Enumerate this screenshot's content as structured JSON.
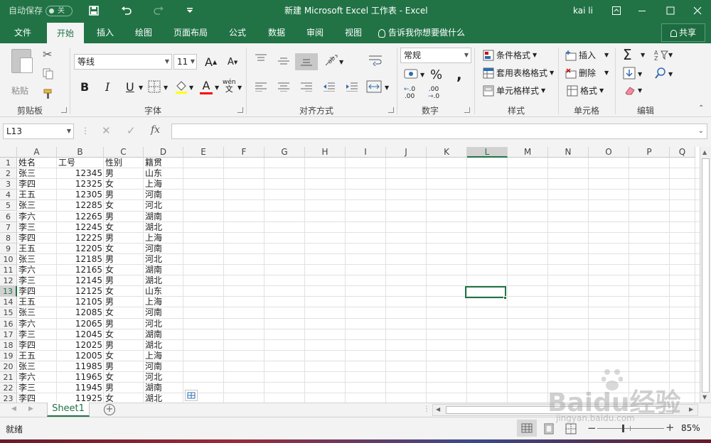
{
  "titlebar": {
    "autosave_label": "自动保存",
    "autosave_state": "关",
    "title": "新建 Microsoft Excel 工作表  -  Excel",
    "user": "kai li"
  },
  "tabs": [
    "文件",
    "开始",
    "插入",
    "绘图",
    "页面布局",
    "公式",
    "数据",
    "审阅",
    "视图"
  ],
  "tell_me": "告诉我你想要做什么",
  "share": "共享",
  "ribbon": {
    "clipboard": {
      "paste": "粘贴",
      "label": "剪贴板"
    },
    "font": {
      "name": "等线",
      "size": "11",
      "bold": "B",
      "italic": "I",
      "underline": "U",
      "label": "字体",
      "grow": "A",
      "shrink": "A",
      "font_color": "A",
      "phonetic": "wén",
      "phonetic2": "文"
    },
    "alignment": {
      "label": "对齐方式"
    },
    "number": {
      "format": "常规",
      "percent": "%",
      "comma": ",",
      "label": "数字",
      "inc": ".0",
      "inc2": ".00",
      "dec": ".00",
      "dec2": ".0"
    },
    "styles": {
      "conditional": "条件格式",
      "table": "套用表格格式",
      "cell": "单元格样式",
      "label": "样式"
    },
    "cells": {
      "insert": "插入",
      "delete": "删除",
      "format": "格式",
      "label": "单元格"
    },
    "editing": {
      "label": "编辑"
    }
  },
  "formula_bar": {
    "name_box": "L13",
    "fx": "fx",
    "value": ""
  },
  "columns": [
    "A",
    "B",
    "C",
    "D",
    "E",
    "F",
    "G",
    "H",
    "I",
    "J",
    "K",
    "L",
    "M",
    "N",
    "O",
    "P",
    "Q"
  ],
  "rows": [
    "1",
    "2",
    "3",
    "4",
    "5",
    "6",
    "7",
    "8",
    "9",
    "10",
    "11",
    "12",
    "13",
    "14",
    "15",
    "16",
    "17",
    "18",
    "19",
    "20",
    "21",
    "22",
    "23"
  ],
  "table": [
    [
      "姓名",
      "工号",
      "性别",
      "籍贯"
    ],
    [
      "张三",
      "12345",
      "男",
      "山东"
    ],
    [
      "李四",
      "12325",
      "女",
      "上海"
    ],
    [
      "王五",
      "12305",
      "男",
      "河南"
    ],
    [
      "张三",
      "12285",
      "女",
      "河北"
    ],
    [
      "李六",
      "12265",
      "男",
      "湖南"
    ],
    [
      "李三",
      "12245",
      "女",
      "湖北"
    ],
    [
      "李四",
      "12225",
      "男",
      "上海"
    ],
    [
      "王五",
      "12205",
      "女",
      "河南"
    ],
    [
      "张三",
      "12185",
      "男",
      "河北"
    ],
    [
      "李六",
      "12165",
      "女",
      "湖南"
    ],
    [
      "李三",
      "12145",
      "男",
      "湖北"
    ],
    [
      "李四",
      "12125",
      "女",
      "山东"
    ],
    [
      "王五",
      "12105",
      "男",
      "上海"
    ],
    [
      "张三",
      "12085",
      "女",
      "河南"
    ],
    [
      "李六",
      "12065",
      "男",
      "河北"
    ],
    [
      "李三",
      "12045",
      "女",
      "湖南"
    ],
    [
      "李四",
      "12025",
      "男",
      "湖北"
    ],
    [
      "王五",
      "12005",
      "女",
      "上海"
    ],
    [
      "张三",
      "11985",
      "男",
      "河南"
    ],
    [
      "李六",
      "11965",
      "女",
      "河北"
    ],
    [
      "李三",
      "11945",
      "男",
      "湖南"
    ],
    [
      "李四",
      "11925",
      "女",
      "湖北"
    ]
  ],
  "active_cell": {
    "col": "L",
    "row": "13"
  },
  "sheet_tab": "Sheet1",
  "status": {
    "ready": "就绪",
    "zoom": "85%",
    "zoom_level": 0.85
  },
  "watermark": {
    "brand": "Baidu经验",
    "url": "jingyan.baidu.com"
  },
  "colors": {
    "excel_green": "#217346",
    "ribbon_bg": "#f3f3f3"
  }
}
